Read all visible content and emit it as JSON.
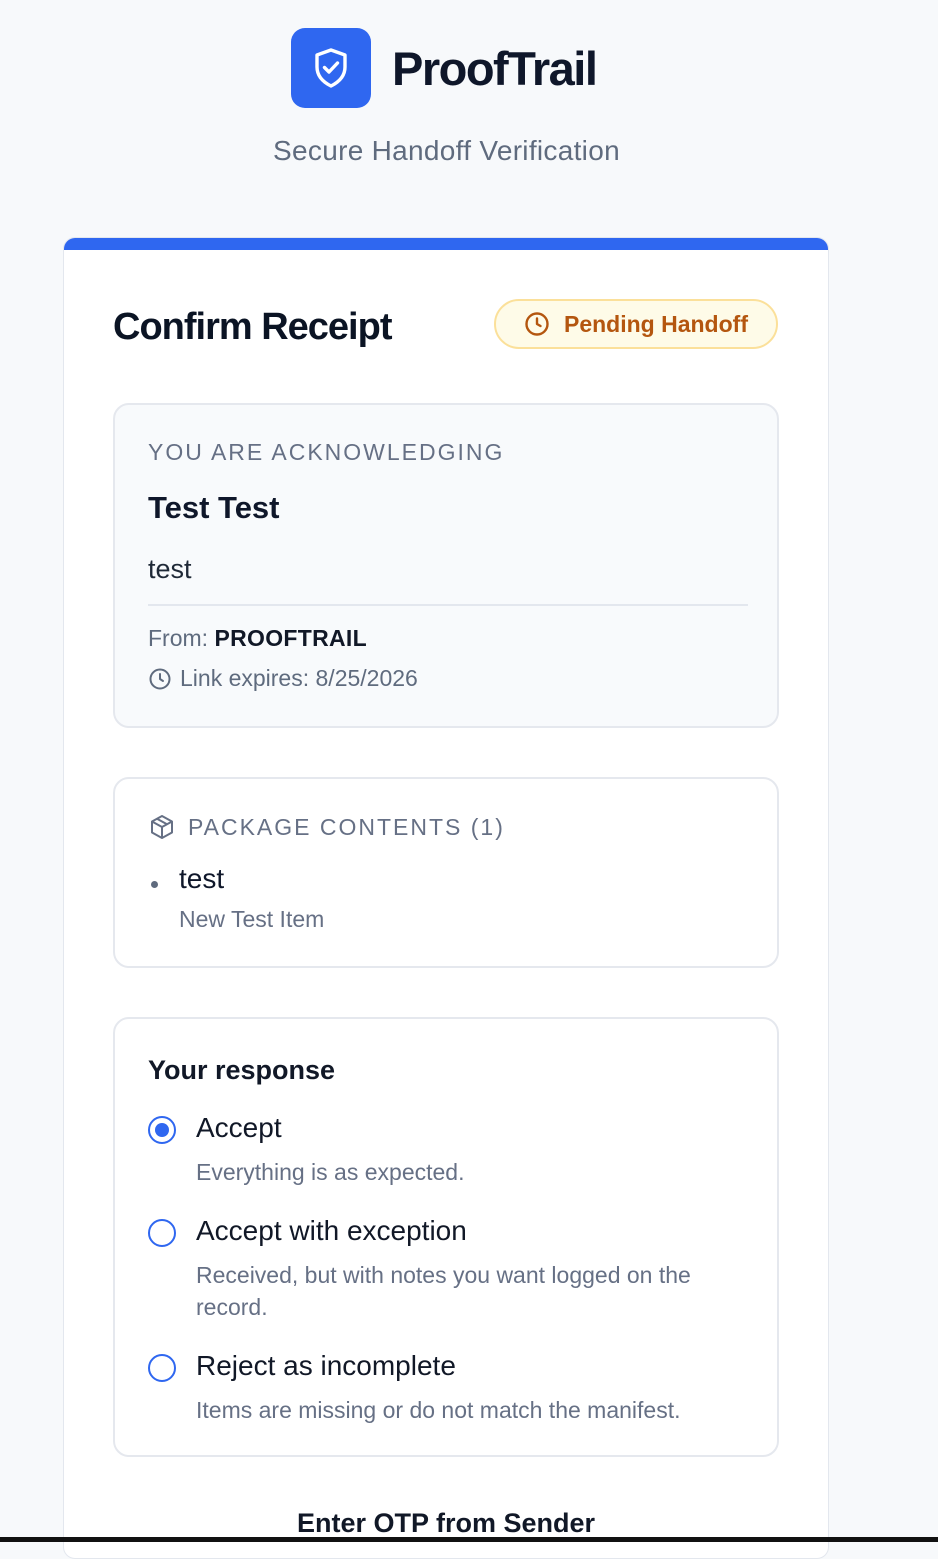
{
  "brand": {
    "name": "ProofTrail",
    "subtitle": "Secure Handoff Verification",
    "logo_icon": "shield-check-icon",
    "accent_color": "#2f67f0"
  },
  "card": {
    "title": "Confirm Receipt",
    "status": {
      "label": "Pending Handoff",
      "icon": "clock-icon",
      "text_color": "#b4560f",
      "background": "#fefbe8",
      "border": "#fbe09a"
    }
  },
  "acknowledging": {
    "heading": "YOU ARE ACKNOWLEDGING",
    "name": "Test Test",
    "description": "test",
    "from_label": "From:",
    "from_value": "PROOFTRAIL",
    "expires_text": "Link expires: 8/25/2026",
    "expires_icon": "clock-icon"
  },
  "package": {
    "heading": "PACKAGE CONTENTS (1)",
    "icon": "package-icon",
    "items": [
      {
        "name": "test",
        "description": "New Test Item"
      }
    ]
  },
  "response": {
    "title": "Your response",
    "selected": "accept",
    "options": [
      {
        "id": "accept",
        "label": "Accept",
        "description": "Everything is as expected.",
        "checked": true
      },
      {
        "id": "accept_exception",
        "label": "Accept with exception",
        "description": "Received, but with notes you want logged on the record.",
        "checked": false
      },
      {
        "id": "reject",
        "label": "Reject as incomplete",
        "description": "Items are missing or do not match the manifest.",
        "checked": false
      }
    ]
  },
  "otp": {
    "label": "Enter OTP from Sender"
  }
}
